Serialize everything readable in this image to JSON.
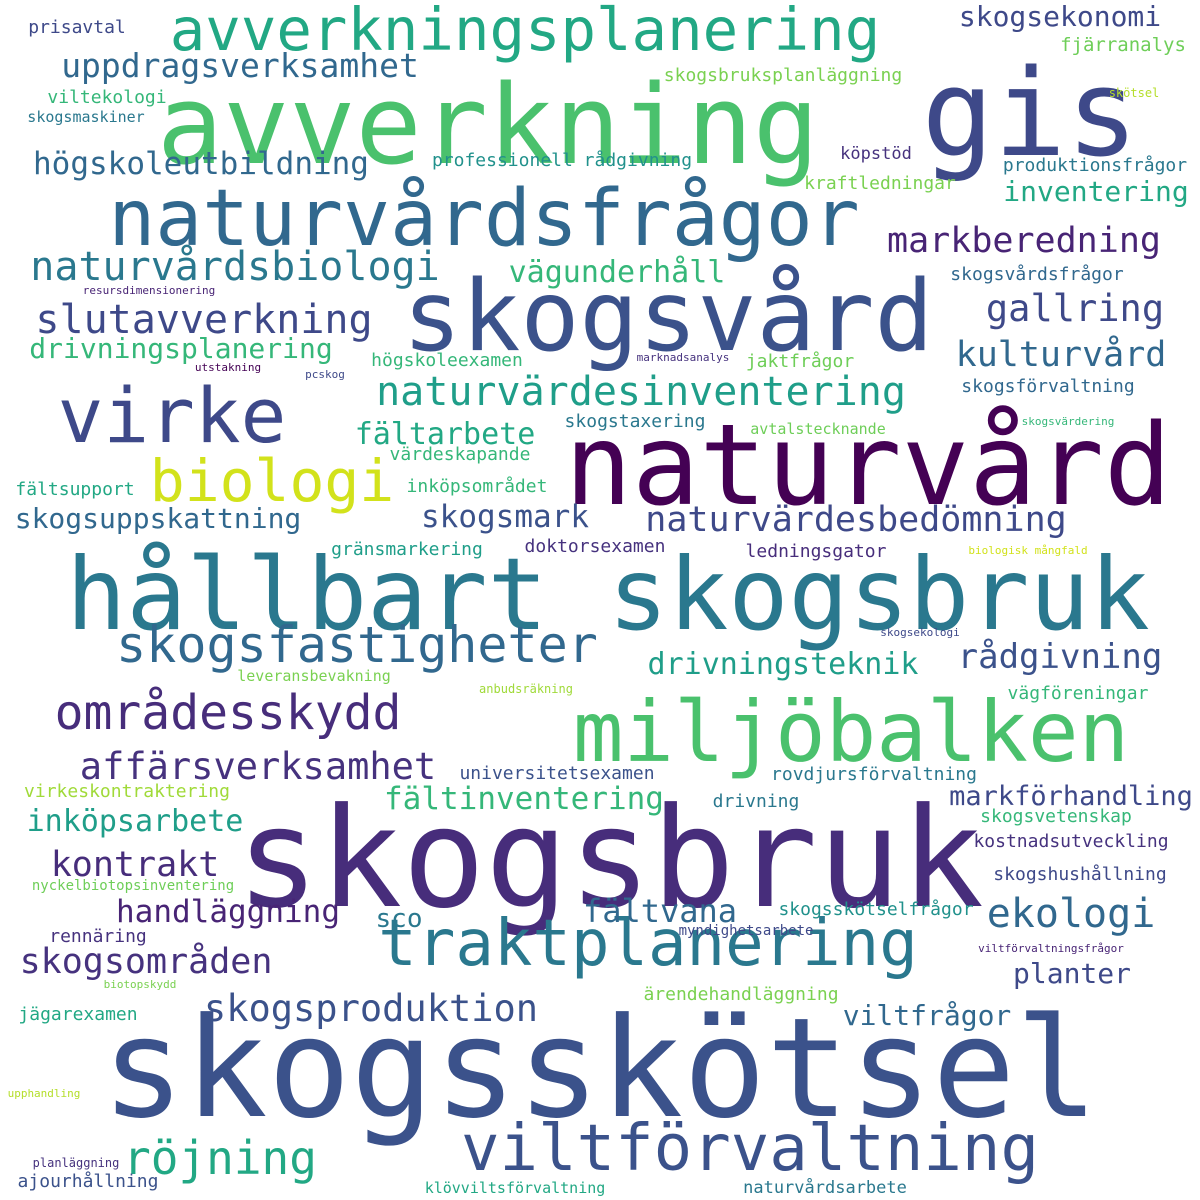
{
  "words": [
    {
      "text": "skogsskötsel",
      "color": "#3b528b"
    },
    {
      "text": "skogsbruk",
      "color": "#472d7b"
    },
    {
      "text": "hållbart skogsbruk",
      "color": "#2a788e"
    },
    {
      "text": "naturvård",
      "color": "#440154"
    },
    {
      "text": "avverkning",
      "color": "#4ac16d"
    },
    {
      "text": "gis",
      "color": "#3e4989"
    },
    {
      "text": "skogsvård",
      "color": "#3b528b"
    },
    {
      "text": "miljöbalken",
      "color": "#4ac16d"
    },
    {
      "text": "naturvårdsfrågor",
      "color": "#31688e"
    },
    {
      "text": "avverkningsplanering",
      "color": "#22a884"
    },
    {
      "text": "virke",
      "color": "#3e4989"
    },
    {
      "text": "traktplanering",
      "color": "#2a788e"
    },
    {
      "text": "viltförvaltning",
      "color": "#3b528b"
    },
    {
      "text": "områdesskydd",
      "color": "#472d7b"
    },
    {
      "text": "biologi",
      "color": "#d2e21b"
    },
    {
      "text": "skogsfastigheter",
      "color": "#31688e"
    },
    {
      "text": "naturvårdsbiologi",
      "color": "#2a788e"
    },
    {
      "text": "slutavverkning",
      "color": "#3e4989"
    },
    {
      "text": "naturvärdesinventering",
      "color": "#1f9e89"
    },
    {
      "text": "uppdragsverksamhet",
      "color": "#31688e"
    },
    {
      "text": "affärsverksamhet",
      "color": "#46327e"
    },
    {
      "text": "röjning",
      "color": "#22a884"
    },
    {
      "text": "skogsproduktion",
      "color": "#3b528b"
    },
    {
      "text": "ekologi",
      "color": "#31688e"
    },
    {
      "text": "markberedning",
      "color": "#482475"
    },
    {
      "text": "högskoleutbildning",
      "color": "#31688e"
    },
    {
      "text": "drivningsplanering",
      "color": "#35b779"
    },
    {
      "text": "gallring",
      "color": "#3e4989"
    },
    {
      "text": "kulturvård",
      "color": "#31688e"
    },
    {
      "text": "skogsområden",
      "color": "#46327e"
    },
    {
      "text": "naturvärdesbedömning",
      "color": "#3e4989"
    },
    {
      "text": "rådgivning",
      "color": "#3b528b"
    },
    {
      "text": "kontrakt",
      "color": "#472d7b"
    },
    {
      "text": "handläggning",
      "color": "#482475"
    },
    {
      "text": "fältinventering",
      "color": "#35b779"
    },
    {
      "text": "fältvana",
      "color": "#31688e"
    },
    {
      "text": "drivningsteknik",
      "color": "#1f9e89"
    },
    {
      "text": "inköpsarbete",
      "color": "#1f9e89"
    },
    {
      "text": "skogsuppskattning",
      "color": "#31688e"
    },
    {
      "text": "fältarbete",
      "color": "#22a884"
    },
    {
      "text": "skogsmark",
      "color": "#3b528b"
    },
    {
      "text": "vägunderhåll",
      "color": "#35b779"
    },
    {
      "text": "skogsekonomi",
      "color": "#3e4989"
    },
    {
      "text": "inventering",
      "color": "#22a884"
    },
    {
      "text": "planter",
      "color": "#3e4989"
    },
    {
      "text": "viltfrågor",
      "color": "#31688e"
    },
    {
      "text": "markförhandling",
      "color": "#3e4989"
    },
    {
      "text": "sco",
      "color": "#2a788e"
    },
    {
      "text": "prisavtal",
      "color": "#3e4989"
    },
    {
      "text": "fjärranalys",
      "color": "#6ece58"
    },
    {
      "text": "skogsbruksplanläggning",
      "color": "#7ad151"
    },
    {
      "text": "skötsel",
      "color": "#b5de2b"
    },
    {
      "text": "viltekologi",
      "color": "#35b779"
    },
    {
      "text": "skogsmaskiner",
      "color": "#2a788e"
    },
    {
      "text": "professionell rådgivning",
      "color": "#21918c"
    },
    {
      "text": "köpstöd",
      "color": "#46327e"
    },
    {
      "text": "produktionsfrågor",
      "color": "#2a788e"
    },
    {
      "text": "kraftledningar",
      "color": "#7ad151"
    },
    {
      "text": "skogsvårdsfrågor",
      "color": "#31688e"
    },
    {
      "text": "resursdimensionering",
      "color": "#482475"
    },
    {
      "text": "högskoleexamen",
      "color": "#35b779"
    },
    {
      "text": "marknadsanalys",
      "color": "#46327e"
    },
    {
      "text": "jaktfrågor",
      "color": "#6ece58"
    },
    {
      "text": "utstakning",
      "color": "#440154"
    },
    {
      "text": "pcskog",
      "color": "#3e4989"
    },
    {
      "text": "skogsförvaltning",
      "color": "#31688e"
    },
    {
      "text": "skogstaxering",
      "color": "#2a788e"
    },
    {
      "text": "avtalstecknande",
      "color": "#6ece58"
    },
    {
      "text": "skogsvärdering",
      "color": "#35b779"
    },
    {
      "text": "värdeskapande",
      "color": "#35b779"
    },
    {
      "text": "fältsupport",
      "color": "#22a884"
    },
    {
      "text": "inköpsområdet",
      "color": "#35b779"
    },
    {
      "text": "gränsmarkering",
      "color": "#1f9e89"
    },
    {
      "text": "doktorsexamen",
      "color": "#46327e"
    },
    {
      "text": "ledningsgator",
      "color": "#472d7b"
    },
    {
      "text": "biologisk mångfald",
      "color": "#d2e21b"
    },
    {
      "text": "skogsekologi",
      "color": "#3e4989"
    },
    {
      "text": "leveransbevakning",
      "color": "#7ad151"
    },
    {
      "text": "anbudsräkning",
      "color": "#a0da39"
    },
    {
      "text": "vägföreningar",
      "color": "#35b779"
    },
    {
      "text": "universitetsexamen",
      "color": "#3b528b"
    },
    {
      "text": "rovdjursförvaltning",
      "color": "#2a788e"
    },
    {
      "text": "virkeskontraktering",
      "color": "#a0da39"
    },
    {
      "text": "drivning",
      "color": "#2a788e"
    },
    {
      "text": "skogsvetenskap",
      "color": "#35b779"
    },
    {
      "text": "kostnadsutveckling",
      "color": "#46327e"
    },
    {
      "text": "nyckelbiotopsinventering",
      "color": "#6ece58"
    },
    {
      "text": "skogshushållning",
      "color": "#3e4989"
    },
    {
      "text": "skogsskötselfrågor",
      "color": "#21918c"
    },
    {
      "text": "rennäring",
      "color": "#46327e"
    },
    {
      "text": "myndighetsarbete",
      "color": "#3e4989"
    },
    {
      "text": "viltförvaltningsfrågor",
      "color": "#482475"
    },
    {
      "text": "biotopskydd",
      "color": "#7ad151"
    },
    {
      "text": "ärendehandläggning",
      "color": "#7ad151"
    },
    {
      "text": "jägarexamen",
      "color": "#22a884"
    },
    {
      "text": "upphandling",
      "color": "#b5de2b"
    },
    {
      "text": "planläggning",
      "color": "#46327e"
    },
    {
      "text": "ajourhållning",
      "color": "#3b528b"
    },
    {
      "text": "klövviltsförvaltning",
      "color": "#22a884"
    },
    {
      "text": "naturvårdsarbete",
      "color": "#2a788e"
    }
  ]
}
